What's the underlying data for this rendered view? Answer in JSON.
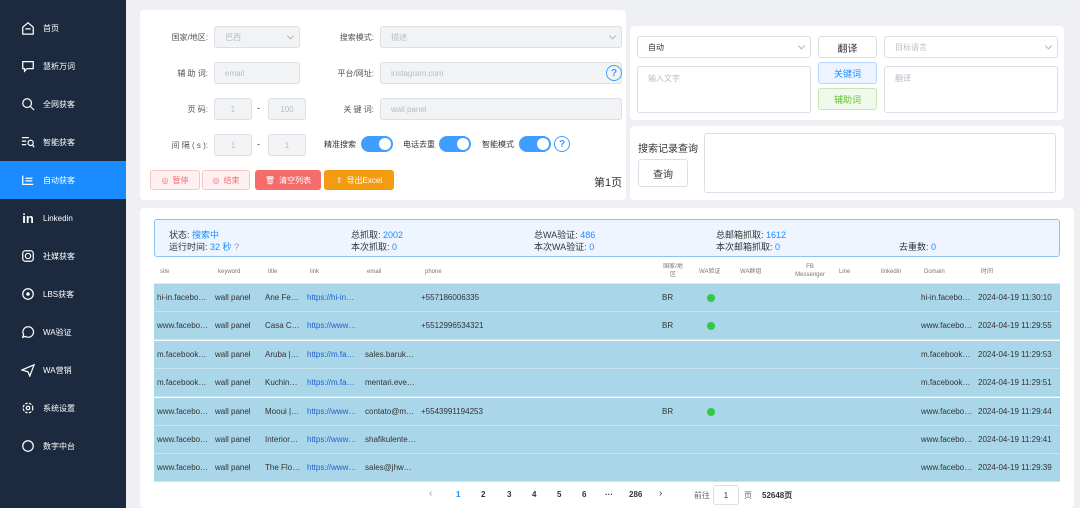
{
  "sidebar": {
    "items": [
      {
        "label": "首页",
        "icon": "home-icon"
      },
      {
        "label": "慧析万词",
        "icon": "chat-icon"
      },
      {
        "label": "全网获客",
        "icon": "search-icon"
      },
      {
        "label": "智能获客",
        "icon": "smart-search-icon"
      },
      {
        "label": "自动获客",
        "icon": "auto-list-icon",
        "active": true
      },
      {
        "label": "Linkedin",
        "icon": "linkedin-icon"
      },
      {
        "label": "社媒获客",
        "icon": "instagram-icon"
      },
      {
        "label": "LBS获客",
        "icon": "lbs-icon"
      },
      {
        "label": "WA验证",
        "icon": "whatsapp-icon"
      },
      {
        "label": "WA营销",
        "icon": "send-icon"
      },
      {
        "label": "系统设置",
        "icon": "gear-icon"
      },
      {
        "label": "数字中台",
        "icon": "circle-icon"
      }
    ]
  },
  "form": {
    "country_label": "国家/地区:",
    "country_value": "巴西",
    "search_mode_label": "搜索模式:",
    "search_mode_value": "描述",
    "aux_label": "辅 助 词:",
    "aux_value": "email",
    "platform_label": "平台/网址:",
    "platform_value": "instagram.com",
    "page_label": "页 码:",
    "page_from": "1",
    "page_to": "100",
    "dash": "-",
    "keyword_label": "关 键 词:",
    "keyword_value": "wall panel",
    "interval_label": "间 隔 ( s ):",
    "interval_from": "1",
    "interval_to": "1",
    "precise_label": "精准搜索",
    "phone_dedup_label": "电话去重",
    "smart_mode_label": "智能模式",
    "help": "?"
  },
  "actions": {
    "pause": "暂停",
    "stop": "结束",
    "clear": "清空列表",
    "export": "导出Excel",
    "page_indicator": "第1页"
  },
  "translate": {
    "auto_label": "自动",
    "translate_button": "翻译",
    "target_lang_placeholder": "目标语言",
    "input_placeholder": "输入文字",
    "keyword_button": "关键词",
    "aux_button": "辅助词",
    "output_placeholder": "翻译"
  },
  "history": {
    "title": "搜索记录查询",
    "query_button": "查询"
  },
  "status": {
    "state_label": "状态:",
    "state_value": "搜索中",
    "runtime_label": "运行时间:",
    "runtime_value": "32 秒",
    "help": "?",
    "total_grab_label": "总抓取:",
    "total_grab_value": "2002",
    "this_grab_label": "本次抓取:",
    "this_grab_value": "0",
    "total_wa_label": "总WA验证:",
    "total_wa_value": "486",
    "this_wa_label": "本次WA验证:",
    "this_wa_value": "0",
    "total_email_label": "总邮箱抓取:",
    "total_email_value": "1612",
    "this_email_label": "本次邮箱抓取:",
    "this_email_value": "0",
    "dedup_label": "去重数:",
    "dedup_value": "0"
  },
  "table": {
    "headers": {
      "site": "site",
      "keyword": "keyword",
      "title": "title",
      "link": "link",
      "email": "email",
      "phone": "phone",
      "country": "国家/地区",
      "wa_verify": "WA验证",
      "wa_group": "WA群组",
      "messenger": "FB Messenger",
      "line": "Line",
      "linkedin": "linkedin",
      "domain": "Domain",
      "time": "时间"
    },
    "rows": [
      {
        "site": "hi-in.facebo…",
        "keyword": "wall panel",
        "title": "Ane Fe…",
        "link": "https://hi-in…",
        "email": "",
        "phone": "+557186006335",
        "country": "BR",
        "wa": true,
        "domain": "hi-in.facebo…",
        "time": "2024-04-19 11:30:10"
      },
      {
        "site": "www.facebo…",
        "keyword": "wall panel",
        "title": "Casa C…",
        "link": "https://www…",
        "email": "",
        "phone": "+5512996534321",
        "country": "BR",
        "wa": true,
        "domain": "www.facebo…",
        "time": "2024-04-19 11:29:55"
      },
      {
        "site": "m.facebook…",
        "keyword": "wall panel",
        "title": "Aruba |…",
        "link": "https://m.fa…",
        "email": "sales.baruk…",
        "phone": "",
        "country": "",
        "wa": false,
        "domain": "m.facebook…",
        "time": "2024-04-19 11:29:53"
      },
      {
        "site": "m.facebook…",
        "keyword": "wall panel",
        "title": "Kuchin…",
        "link": "https://m.fa…",
        "email": "mentari.eve…",
        "phone": "",
        "country": "",
        "wa": false,
        "domain": "m.facebook…",
        "time": "2024-04-19 11:29:51"
      },
      {
        "site": "www.facebo…",
        "keyword": "wall panel",
        "title": "Mooui |…",
        "link": "https://www…",
        "email": "contato@m…",
        "phone": "+5543991194253",
        "country": "BR",
        "wa": true,
        "domain": "www.facebo…",
        "time": "2024-04-19 11:29:44"
      },
      {
        "site": "www.facebo…",
        "keyword": "wall panel",
        "title": "Interior…",
        "link": "https://www…",
        "email": "shafikulente…",
        "phone": "",
        "country": "",
        "wa": false,
        "domain": "www.facebo…",
        "time": "2024-04-19 11:29:41"
      },
      {
        "site": "www.facebo…",
        "keyword": "wall panel",
        "title": "The Flo…",
        "link": "https://www…",
        "email": "sales@jhw…",
        "phone": "",
        "country": "",
        "wa": false,
        "domain": "www.facebo…",
        "time": "2024-04-19 11:29:39"
      }
    ]
  },
  "pagination": {
    "prev": "‹",
    "pages": [
      "1",
      "2",
      "3",
      "4",
      "5",
      "6"
    ],
    "ellipsis": "···",
    "last": "286",
    "next": "›",
    "goto_label": "前往",
    "goto_value": "1",
    "page_unit": "页",
    "total": "52648页"
  },
  "colors": {
    "sidebar_bg": "#1b2a3e",
    "active": "#1a8cff",
    "row_bg": "#a9d6e9",
    "clear_btn": "#f56c6c",
    "export_btn": "#f39c12",
    "wa_dot": "#2ecc40"
  }
}
